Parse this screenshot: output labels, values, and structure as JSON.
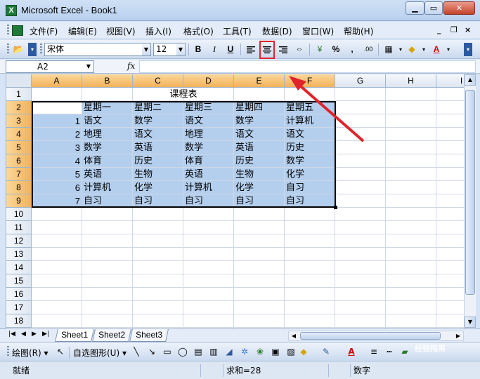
{
  "window": {
    "title": "Microsoft Excel - Book1"
  },
  "menubar": {
    "items": [
      "文件(F)",
      "编辑(E)",
      "视图(V)",
      "插入(I)",
      "格式(O)",
      "工具(T)",
      "数据(D)",
      "窗口(W)",
      "帮助(H)"
    ]
  },
  "toolbar": {
    "font_name": "宋体",
    "font_size": "12",
    "bold": "B",
    "italic": "I",
    "underline": "U",
    "percent": "%",
    "comma": ",",
    "font_color_label": "A"
  },
  "formula_bar": {
    "name_box": "A2",
    "fx": "fx",
    "formula": ""
  },
  "grid": {
    "columns": [
      "A",
      "B",
      "C",
      "D",
      "E",
      "F",
      "G",
      "H",
      "I"
    ],
    "rows": [
      "1",
      "2",
      "3",
      "4",
      "5",
      "6",
      "7",
      "8",
      "9",
      "10",
      "11",
      "12",
      "13",
      "14",
      "15",
      "16",
      "17",
      "18"
    ],
    "title": "课程表",
    "header": [
      "",
      "星期一",
      "星期二",
      "星期三",
      "星期四",
      "星期五"
    ],
    "body": [
      [
        "1",
        "语文",
        "数学",
        "语文",
        "数学",
        "计算机"
      ],
      [
        "2",
        "地理",
        "语文",
        "地理",
        "语文",
        "语文"
      ],
      [
        "3",
        "数学",
        "英语",
        "数学",
        "英语",
        "历史"
      ],
      [
        "4",
        "体育",
        "历史",
        "体育",
        "历史",
        "数学"
      ],
      [
        "5",
        "英语",
        "生物",
        "英语",
        "生物",
        "化学"
      ],
      [
        "6",
        "计算机",
        "化学",
        "计算机",
        "化学",
        "自习"
      ],
      [
        "7",
        "自习",
        "自习",
        "自习",
        "自习",
        "自习"
      ]
    ]
  },
  "sheets": {
    "tabs": [
      "Sheet1",
      "Sheet2",
      "Sheet3"
    ],
    "active": "Sheet1"
  },
  "drawbar": {
    "draw_label": "绘图(R)",
    "autoshapes_label": "自选图形(U)"
  },
  "statusbar": {
    "ready": "就绪",
    "sum": "求和=28",
    "mode": "数字"
  },
  "watermark": {
    "text": "经验指南"
  },
  "colors": {
    "accent_red": "#e0242c",
    "selection": "#b4cfee",
    "header_selected": "#f3b25a"
  }
}
